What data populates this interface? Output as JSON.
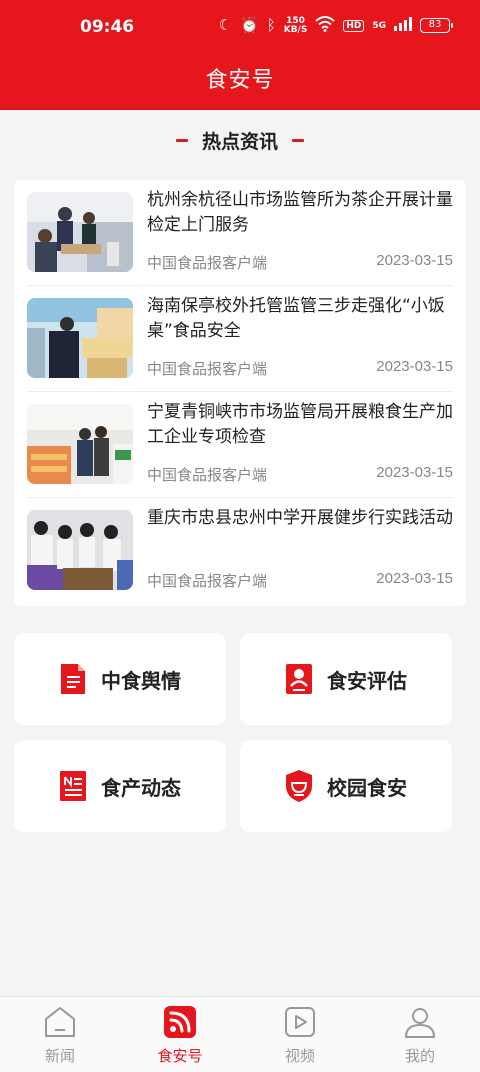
{
  "status_bar": {
    "time": "09:46",
    "speed_value": "150",
    "speed_unit": "KB/S",
    "hd": "HD",
    "signal": "5G",
    "battery": "83"
  },
  "header": {
    "title": "食安号"
  },
  "hot_news": {
    "heading": "热点资讯",
    "items": [
      {
        "title": "杭州余杭径山市场监管所为茶企开展计量检定上门服务",
        "source": "中国食品报客户端",
        "date": "2023-03-15"
      },
      {
        "title": "海南保亭校外托管监管三步走强化“小饭桌”食品安全",
        "source": "中国食品报客户端",
        "date": "2023-03-15"
      },
      {
        "title": "宁夏青铜峡市市场监管局开展粮食生产加工企业专项检查",
        "source": "中国食品报客户端",
        "date": "2023-03-15"
      },
      {
        "title": "重庆市忠县忠州中学开展健步行实践活动",
        "source": "中国食品报客户端",
        "date": "2023-03-15"
      }
    ]
  },
  "tiles": [
    {
      "label": "中食舆情",
      "icon": "document-icon"
    },
    {
      "label": "食安评估",
      "icon": "id-card-icon"
    },
    {
      "label": "食产动态",
      "icon": "news-icon"
    },
    {
      "label": "校园食安",
      "icon": "shield-bowl-icon"
    }
  ],
  "bottom_nav": [
    {
      "label": "新闻",
      "icon": "home-icon",
      "active": false
    },
    {
      "label": "食安号",
      "icon": "rss-icon",
      "active": true
    },
    {
      "label": "视频",
      "icon": "play-icon",
      "active": false
    },
    {
      "label": "我的",
      "icon": "user-icon",
      "active": false
    }
  ],
  "colors": {
    "brand": "#e5161c",
    "background": "#f4f4f4",
    "muted_text": "#888888"
  }
}
